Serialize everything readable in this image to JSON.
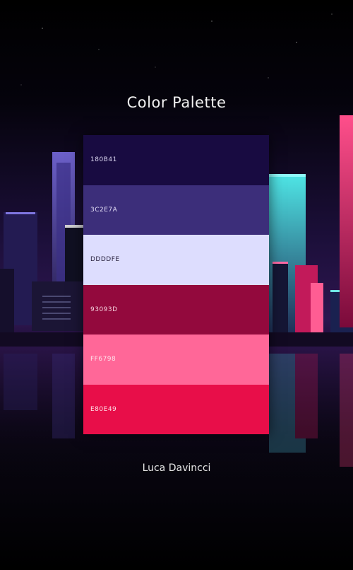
{
  "title": "Color Palette",
  "author": "Luca Davincci",
  "palette": [
    {
      "label": "180B41",
      "color": "#180B41",
      "text_color": "#d8d4ee"
    },
    {
      "label": "3C2E7A",
      "color": "#3C2E7A",
      "text_color": "#e2ddf5"
    },
    {
      "label": "DDDDFE",
      "color": "#DDDDFE",
      "text_color": "#2a2440"
    },
    {
      "label": "93093D",
      "color": "#93093D",
      "text_color": "#f3d0dc"
    },
    {
      "label": "FF6798",
      "color": "#FF6798",
      "text_color": "#fde4ec"
    },
    {
      "label": "E80E49",
      "color": "#E80E49",
      "text_color": "#fde0e7"
    }
  ]
}
